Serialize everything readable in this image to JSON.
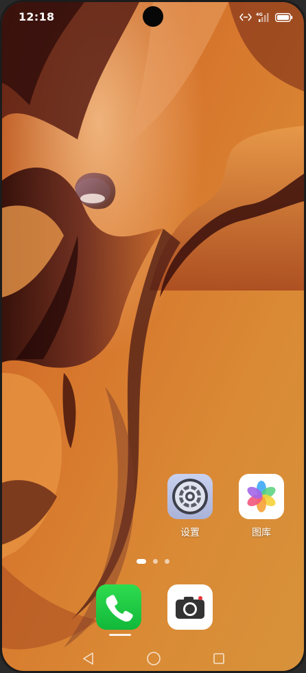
{
  "status_bar": {
    "time": "12:18",
    "network_label": "4G"
  },
  "home": {
    "apps": [
      {
        "label": "设置",
        "icon": "settings-gear-icon"
      },
      {
        "label": "图库",
        "icon": "gallery-flower-icon"
      }
    ],
    "page_indicator": {
      "pages": 3,
      "current": 1
    }
  },
  "dock": {
    "apps": [
      {
        "icon": "phone-icon",
        "color": "#18c93a"
      },
      {
        "icon": "camera-icon",
        "color": "#ffffff"
      }
    ]
  },
  "navigation": {
    "back": "back-triangle-icon",
    "home": "home-circle-icon",
    "recents": "recents-square-icon"
  },
  "colors": {
    "wallpaper_primary": "#d9822f",
    "wallpaper_dark": "#4a1a10",
    "status_text": "#ffffff"
  }
}
